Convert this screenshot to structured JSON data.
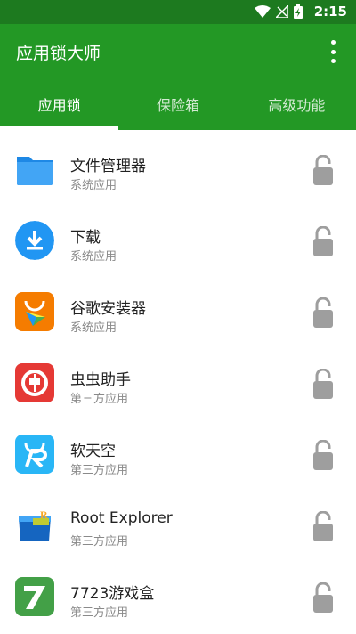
{
  "status_bar": {
    "time": "2:15",
    "icons": [
      "wifi-icon",
      "no-signal-icon",
      "battery-charging-icon"
    ]
  },
  "app_bar": {
    "title": "应用锁大师",
    "menu_icon": "more-vert-icon",
    "color": "#239825"
  },
  "tabs": [
    {
      "label": "应用锁",
      "active": true
    },
    {
      "label": "保险箱",
      "active": false
    },
    {
      "label": "高级功能",
      "active": false
    }
  ],
  "apps": [
    {
      "name": "文件管理器",
      "type": "系统应用",
      "icon": "folder-icon",
      "locked": false
    },
    {
      "name": "下载",
      "type": "系统应用",
      "icon": "download-icon",
      "locked": false
    },
    {
      "name": "谷歌安装器",
      "type": "系统应用",
      "icon": "google-installer-icon",
      "locked": false
    },
    {
      "name": "虫虫助手",
      "type": "第三方应用",
      "icon": "chongchong-icon",
      "locked": false
    },
    {
      "name": "软天空",
      "type": "第三方应用",
      "icon": "ruantiankong-icon",
      "locked": false
    },
    {
      "name": "Root Explorer",
      "type": "第三方应用",
      "icon": "root-explorer-icon",
      "locked": false
    },
    {
      "name": "7723游戏盒",
      "type": "第三方应用",
      "icon": "7723-icon",
      "locked": false
    }
  ]
}
